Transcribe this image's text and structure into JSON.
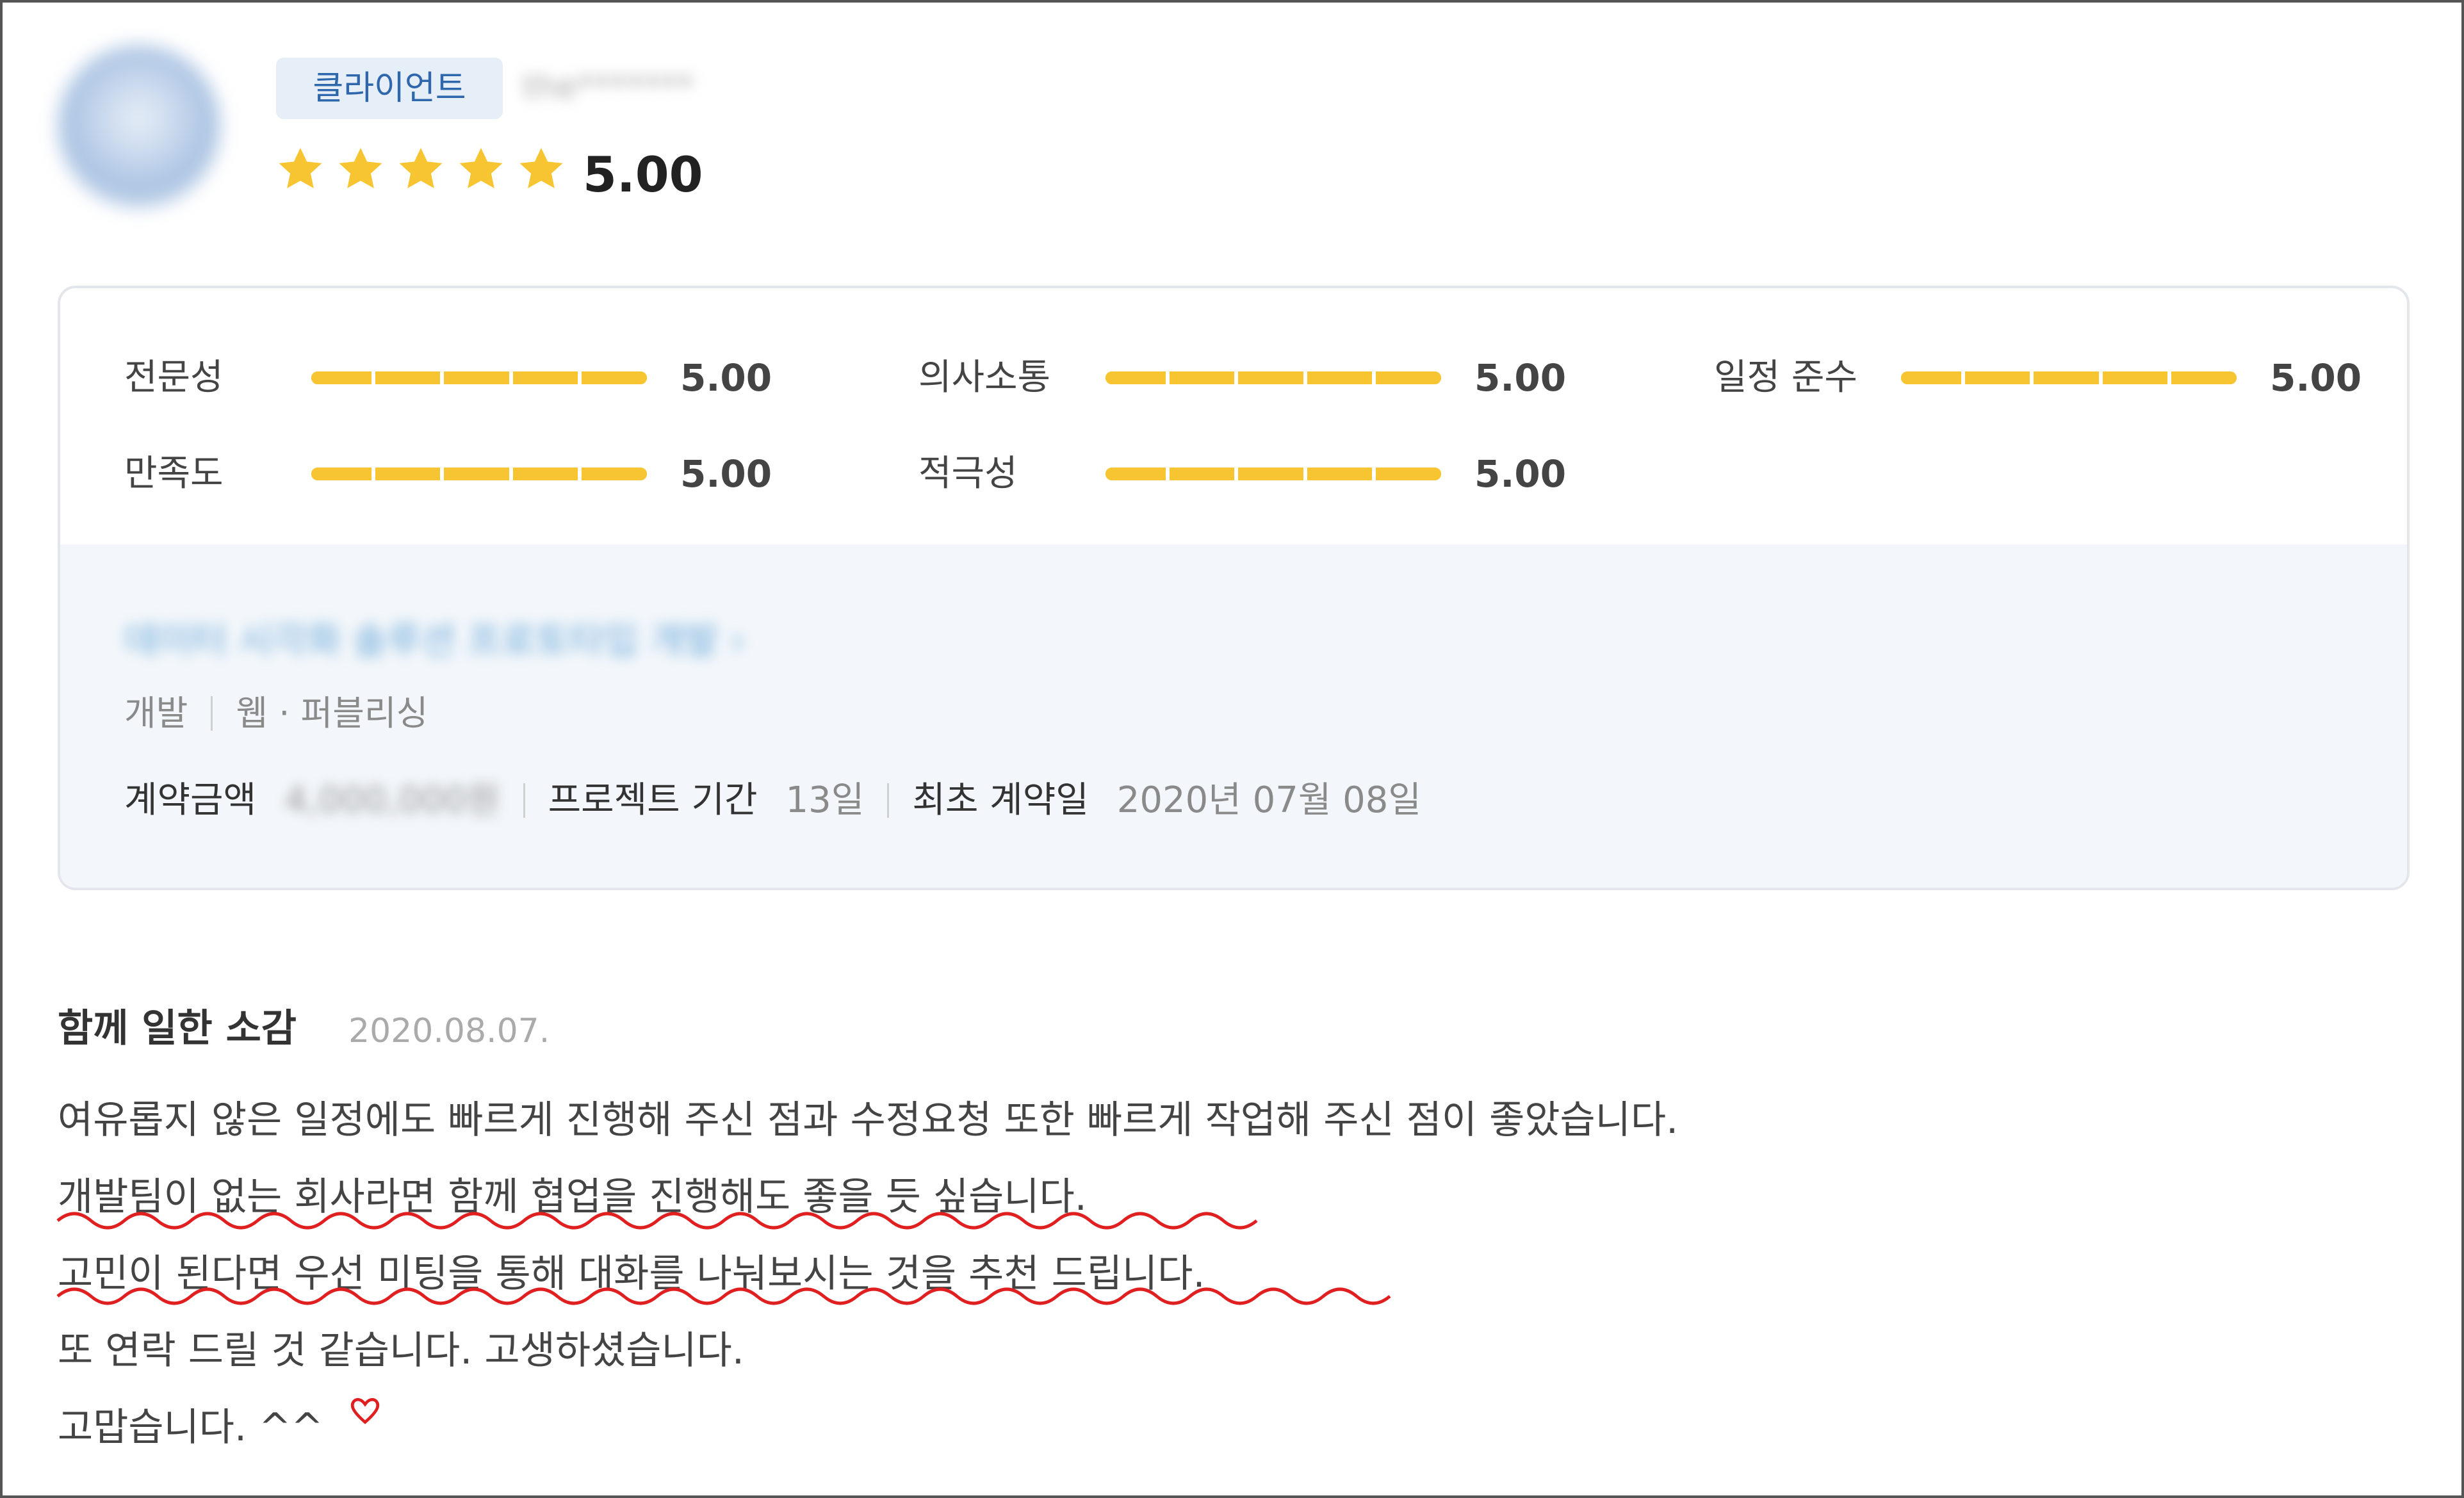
{
  "header": {
    "badge": "클라이언트",
    "username": "the*******",
    "score": "5.00",
    "stars": 5,
    "star_color": "#f7c531",
    "avatar_icon": "user-avatar"
  },
  "ratings": [
    {
      "label": "전문성",
      "value": "5.00",
      "fill": 1.0
    },
    {
      "label": "의사소통",
      "value": "5.00",
      "fill": 1.0
    },
    {
      "label": "일정 준수",
      "value": "5.00",
      "fill": 1.0
    },
    {
      "label": "만족도",
      "value": "5.00",
      "fill": 1.0
    },
    {
      "label": "적극성",
      "value": "5.00",
      "fill": 1.0
    }
  ],
  "project": {
    "title": "데이터 시각화 솔루션 프로토타입 개발",
    "chevron_icon": "chevron-right-icon",
    "category_main": "개발",
    "category_sub": "웹 · 퍼블리싱",
    "contract_amount_label": "계약금액",
    "contract_amount_value": "4,000,000원",
    "duration_label": "프로젝트 기간",
    "duration_value": "13일",
    "first_contract_label": "최초 계약일",
    "first_contract_value": "2020년 07월 08일"
  },
  "review": {
    "heading": "함께 일한 소감",
    "date": "2020.08.07.",
    "lines": [
      "여유롭지 않은 일정에도 빠르게 진행해 주신 점과 수정요청 또한 빠르게 작업해 주신 점이 좋았습니다.",
      "개발팀이 없는 회사라면 함께 협업을 진행해도 좋을 듯 싶습니다.",
      "고민이 된다면 우선 미팅을 통해 대화를 나눠보시는 것을 추천 드립니다.",
      "또 연락 드릴 것 같습니다. 고생하셨습니다.",
      "고맙습니다. ^^"
    ],
    "annotation_color": "#e02020",
    "heart_icon": "heart-icon"
  }
}
